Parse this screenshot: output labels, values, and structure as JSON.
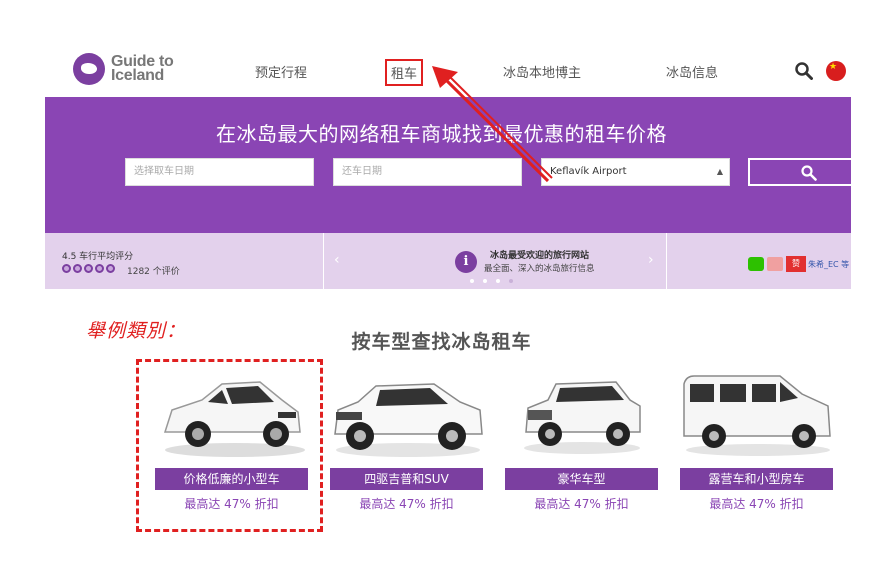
{
  "header": {
    "logo_line1": "Guide to",
    "logo_line2": "Iceland",
    "nav": [
      "预定行程",
      "租车",
      "冰岛本地博主",
      "冰岛信息"
    ]
  },
  "hero": {
    "title": "在冰岛最大的网络租车商城找到最优惠的租车价格",
    "pickup_placeholder": "选择取车日期",
    "return_placeholder": "还车日期",
    "location_value": "Keflavík Airport",
    "bg_color": "#8a45b4"
  },
  "infobar": {
    "rating_title": "4.5 车行平均评分",
    "rating_stars": 5,
    "rating_count": "1282 个评价",
    "promo_title": "冰岛最受欢迎的旅行网站",
    "promo_subtitle": "最全面、深入的冰岛旅行信息",
    "like_label": "赞",
    "social_user": "朱希_EC 等"
  },
  "annotation": {
    "label": "舉例類別："
  },
  "categories": {
    "title": "按车型查找冰岛租车",
    "items": [
      {
        "label": "价格低廉的小型车",
        "discount": "最高达 47% 折扣"
      },
      {
        "label": "四驱吉普和SUV",
        "discount": "最高达 47% 折扣"
      },
      {
        "label": "豪华车型",
        "discount": "最高达 47% 折扣"
      },
      {
        "label": "露营车和小型房车",
        "discount": "最高达 47% 折扣"
      }
    ]
  }
}
